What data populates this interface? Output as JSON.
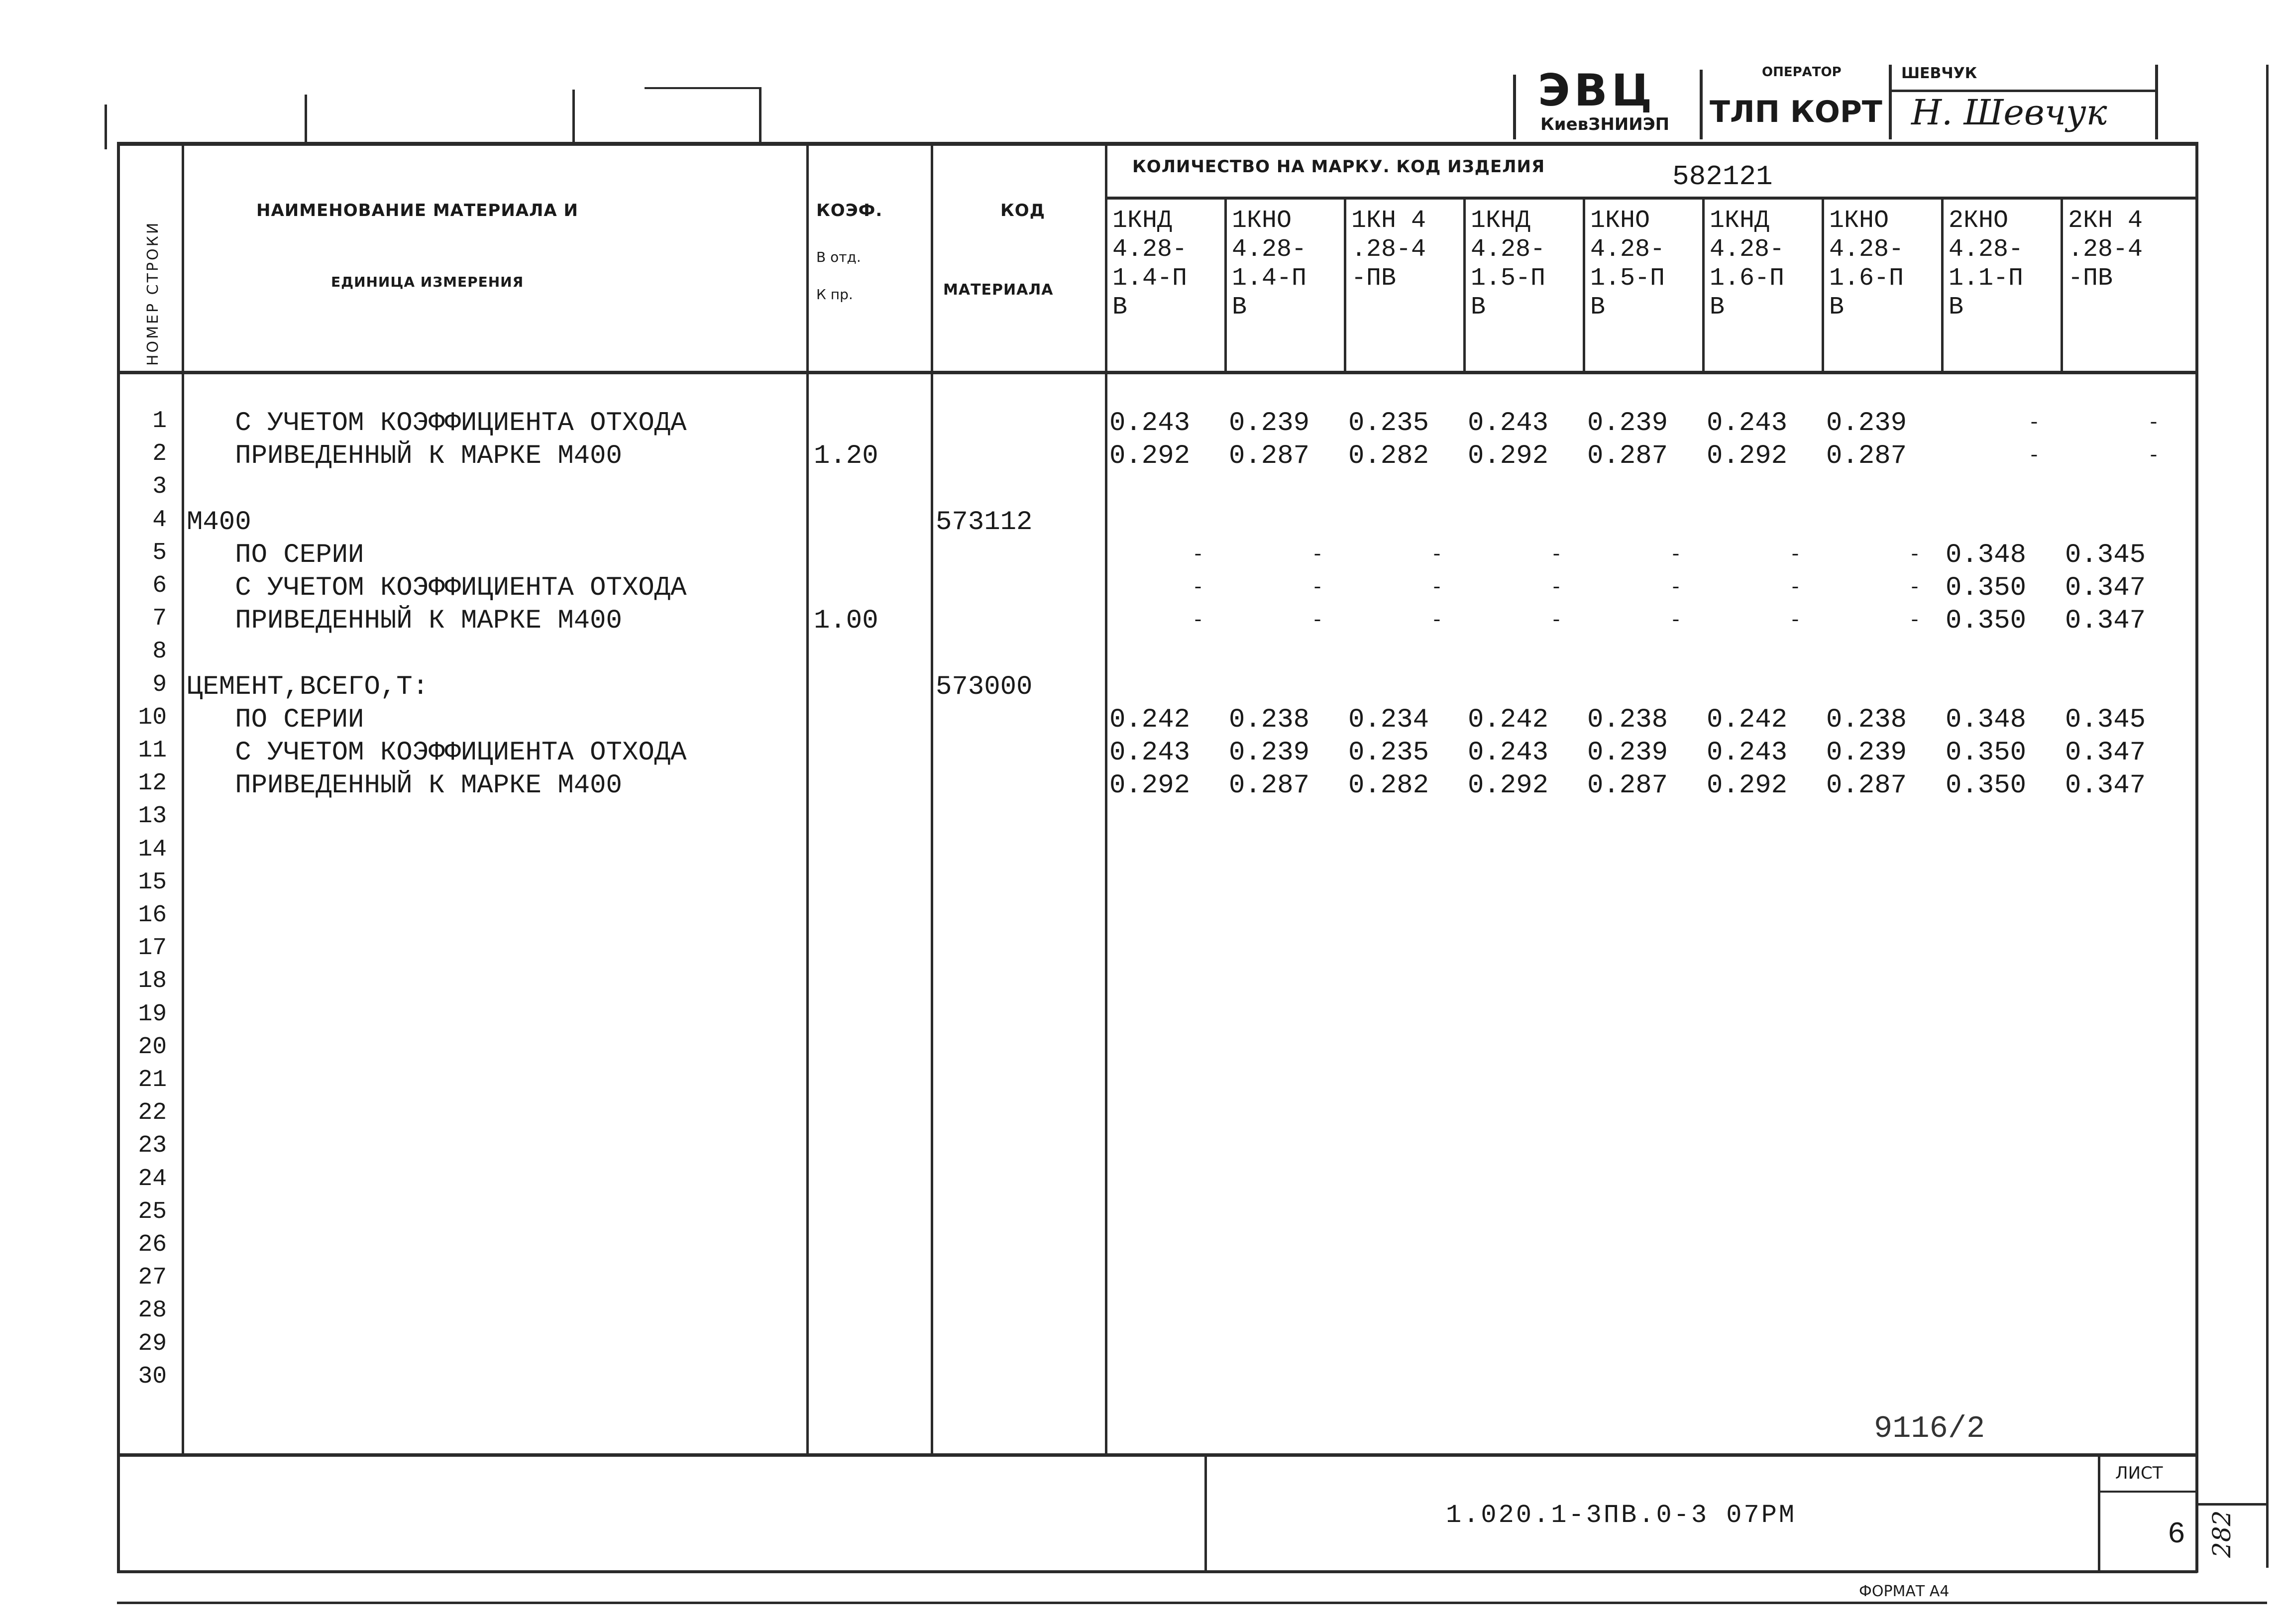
{
  "title_block": {
    "organization_code": "ЭВЦ",
    "organization_name": "КиевЗНИИЭП",
    "operator_label": "ОПЕРАТОР",
    "operator_value": "ТЛП КОРТ",
    "checker_label": "ШЕВЧУК",
    "signature": "Н. Шевчук"
  },
  "table": {
    "header": {
      "row_number_label": "НОМЕР СТРОКИ",
      "material_name_line1": "НАИМЕНОВАНИЕ МАТЕРИАЛА И",
      "material_name_line2": "ЕДИНИЦА ИЗМЕРЕНИЯ",
      "coef_line1": "КОЭФ.",
      "coef_line2": "В отд.",
      "coef_line3": "К пр.",
      "code_line1": "КОД",
      "code_line2": "МАТЕРИАЛА",
      "quantity_label": "КОЛИЧЕСТВО НА МАРКУ. КОД ИЗДЕЛИЯ",
      "product_code": "582121",
      "mark_columns": [
        [
          "1КНД",
          "4.28-",
          "1.4-П",
          "В"
        ],
        [
          "1КНО",
          "4.28-",
          "1.4-П",
          "В"
        ],
        [
          "1КН 4",
          ".28-4",
          "-ПВ",
          ""
        ],
        [
          "1КНД",
          "4.28-",
          "1.5-П",
          "В"
        ],
        [
          "1КНО",
          "4.28-",
          "1.5-П",
          "В"
        ],
        [
          "1КНД",
          "4.28-",
          "1.6-П",
          "В"
        ],
        [
          "1КНО",
          "4.28-",
          "1.6-П",
          "В"
        ],
        [
          "2КНО",
          "4.28-",
          "1.1-П",
          "В"
        ],
        [
          "2КН 4",
          ".28-4",
          "-ПВ",
          ""
        ]
      ]
    },
    "row_numbers": [
      "1",
      "2",
      "3",
      "4",
      "5",
      "6",
      "7",
      "8",
      "9",
      "10",
      "11",
      "12",
      "13",
      "14",
      "15",
      "16",
      "17",
      "18",
      "19",
      "20",
      "21",
      "22",
      "23",
      "24",
      "25",
      "26",
      "27",
      "28",
      "29",
      "30"
    ],
    "rows": [
      {
        "n": "1",
        "name": "   С УЧЕТОМ КОЭФФИЦИЕНТА ОТХОДА",
        "coef": "",
        "code": "",
        "values": [
          "0.243",
          "0.239",
          "0.235",
          "0.243",
          "0.239",
          "0.243",
          "0.239",
          "-",
          "-"
        ]
      },
      {
        "n": "2",
        "name": "   ПРИВЕДЕННЫЙ К МАРКЕ М400",
        "coef": "1.20",
        "code": "",
        "values": [
          "0.292",
          "0.287",
          "0.282",
          "0.292",
          "0.287",
          "0.292",
          "0.287",
          "-",
          "-"
        ]
      },
      {
        "n": "4",
        "name": "М400",
        "coef": "",
        "code": "573112",
        "values": [
          "",
          "",
          "",
          "",
          "",
          "",
          "",
          "",
          ""
        ]
      },
      {
        "n": "5",
        "name": "   ПО СЕРИИ",
        "coef": "",
        "code": "",
        "values": [
          "-",
          "-",
          "-",
          "-",
          "-",
          "-",
          "-",
          "0.348",
          "0.345"
        ]
      },
      {
        "n": "6",
        "name": "   С УЧЕТОМ КОЭФФИЦИЕНТА ОТХОДА",
        "coef": "",
        "code": "",
        "values": [
          "-",
          "-",
          "-",
          "-",
          "-",
          "-",
          "-",
          "0.350",
          "0.347"
        ]
      },
      {
        "n": "7",
        "name": "   ПРИВЕДЕННЫЙ К МАРКЕ М400",
        "coef": "1.00",
        "code": "",
        "values": [
          "-",
          "-",
          "-",
          "-",
          "-",
          "-",
          "-",
          "0.350",
          "0.347"
        ]
      },
      {
        "n": "9",
        "name": "ЦЕМЕНТ,ВСЕГО,Т:",
        "coef": "",
        "code": "573000",
        "values": [
          "",
          "",
          "",
          "",
          "",
          "",
          "",
          "",
          ""
        ]
      },
      {
        "n": "10",
        "name": "   ПО СЕРИИ",
        "coef": "",
        "code": "",
        "values": [
          "0.242",
          "0.238",
          "0.234",
          "0.242",
          "0.238",
          "0.242",
          "0.238",
          "0.348",
          "0.345"
        ]
      },
      {
        "n": "11",
        "name": "   С УЧЕТОМ КОЭФФИЦИЕНТА ОТХОДА",
        "coef": "",
        "code": "",
        "values": [
          "0.243",
          "0.239",
          "0.235",
          "0.243",
          "0.239",
          "0.243",
          "0.239",
          "0.350",
          "0.347"
        ]
      },
      {
        "n": "12",
        "name": "   ПРИВЕДЕННЫЙ К МАРКЕ М400",
        "coef": "",
        "code": "",
        "values": [
          "0.292",
          "0.287",
          "0.282",
          "0.292",
          "0.287",
          "0.292",
          "0.287",
          "0.350",
          "0.347"
        ]
      }
    ]
  },
  "footer": {
    "archive_number": "9116/2",
    "document_code": "1.020.1-3ПВ.0-3 07РМ",
    "sheet_label": "ЛИСТ",
    "sheet_number": "6",
    "format_label": "ФОРМАТ А4",
    "side_stamp": "282"
  }
}
